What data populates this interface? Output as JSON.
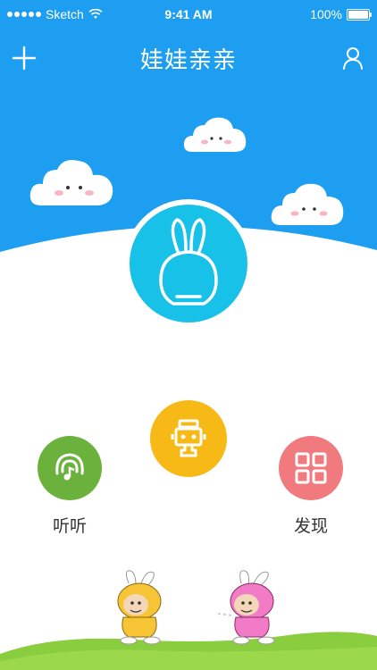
{
  "status_bar": {
    "carrier": "Sketch",
    "time": "9:41 AM",
    "battery": "100%"
  },
  "nav": {
    "title": "娃娃亲亲",
    "left_icon": "plus-icon",
    "right_icon": "user-icon"
  },
  "colors": {
    "header_blue": "#1E9EF1",
    "logo_cyan": "#17C1E8",
    "listen_green": "#6AB23C",
    "robot_yellow": "#F6B915",
    "discover_red": "#F07A7E",
    "grass_green": "#8ACD3E"
  },
  "features": {
    "listen": {
      "label": "听听",
      "icon": "headphones-music-icon"
    },
    "robot": {
      "icon": "robot-icon"
    },
    "discover": {
      "label": "发现",
      "icon": "grid-icon"
    }
  }
}
